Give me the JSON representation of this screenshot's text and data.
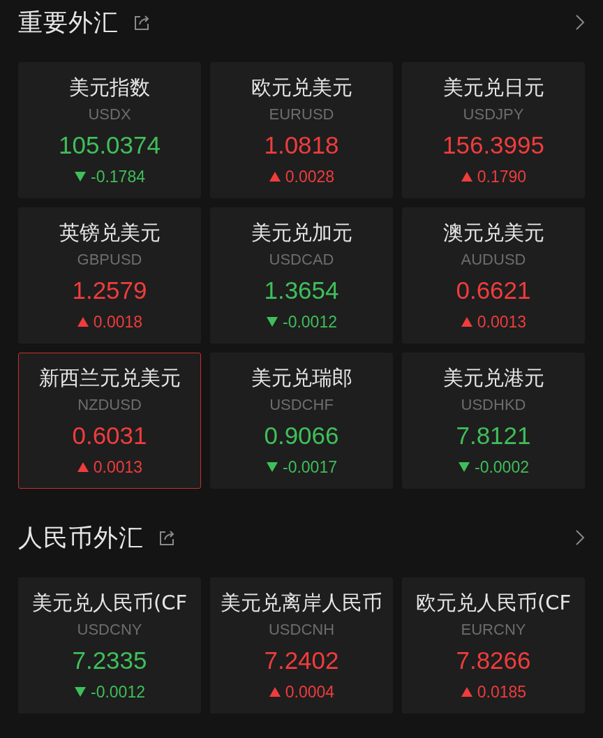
{
  "sections": [
    {
      "title": "重要外汇",
      "cards": [
        {
          "name": "美元指数",
          "code": "USDX",
          "price": "105.0374",
          "kind": "down",
          "change": "-0.1784",
          "selected": false
        },
        {
          "name": "欧元兑美元",
          "code": "EURUSD",
          "price": "1.0818",
          "kind": "up",
          "change": "0.0028",
          "selected": false
        },
        {
          "name": "美元兑日元",
          "code": "USDJPY",
          "price": "156.3995",
          "kind": "up",
          "change": "0.1790",
          "selected": false
        },
        {
          "name": "英镑兑美元",
          "code": "GBPUSD",
          "price": "1.2579",
          "kind": "up",
          "change": "0.0018",
          "selected": false
        },
        {
          "name": "美元兑加元",
          "code": "USDCAD",
          "price": "1.3654",
          "kind": "down",
          "change": "-0.0012",
          "selected": false
        },
        {
          "name": "澳元兑美元",
          "code": "AUDUSD",
          "price": "0.6621",
          "kind": "up",
          "change": "0.0013",
          "selected": false
        },
        {
          "name": "新西兰元兑美元",
          "code": "NZDUSD",
          "price": "0.6031",
          "kind": "up",
          "change": "0.0013",
          "selected": true
        },
        {
          "name": "美元兑瑞郎",
          "code": "USDCHF",
          "price": "0.9066",
          "kind": "down",
          "change": "-0.0017",
          "selected": false
        },
        {
          "name": "美元兑港元",
          "code": "USDHKD",
          "price": "7.8121",
          "kind": "down",
          "change": "-0.0002",
          "selected": false
        }
      ]
    },
    {
      "title": "人民币外汇",
      "cards": [
        {
          "name": "美元兑人民币(CF",
          "code": "USDCNY",
          "price": "7.2335",
          "kind": "down",
          "change": "-0.0012",
          "selected": false
        },
        {
          "name": "美元兑离岸人民币",
          "code": "USDCNH",
          "price": "7.2402",
          "kind": "up",
          "change": "0.0004",
          "selected": false
        },
        {
          "name": "欧元兑人民币(CF",
          "code": "EURCNY",
          "price": "7.8266",
          "kind": "up",
          "change": "0.0185",
          "selected": false
        }
      ]
    }
  ]
}
